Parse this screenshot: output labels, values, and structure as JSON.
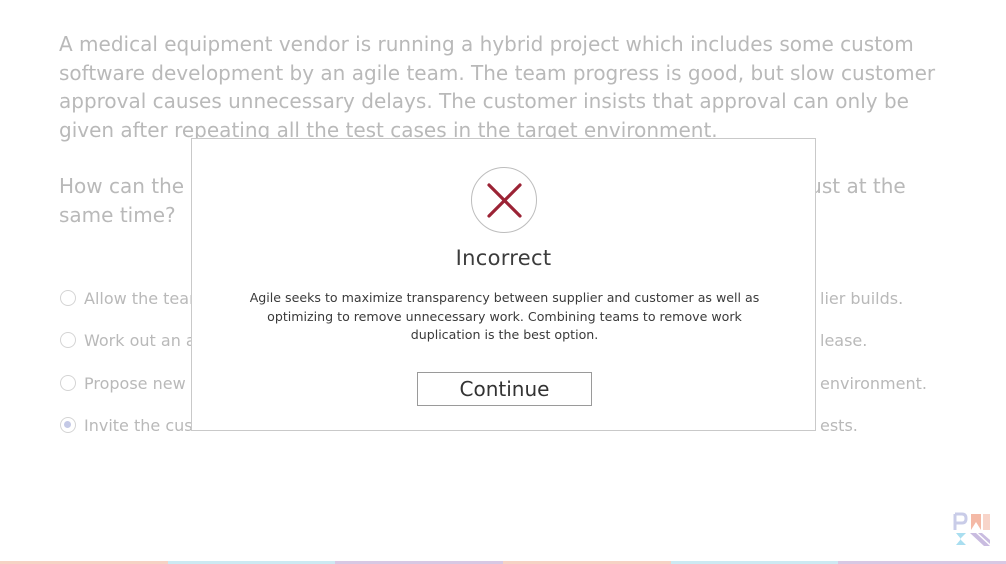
{
  "question": {
    "paragraph1": "A medical equipment vendor is running a hybrid project which includes some custom software development by an agile team.  The team progress is good, but slow customer approval causes unnecessary delays. The customer insists that approval can only be given after repeating all the test cases in the target environment.",
    "paragraph2_left": "How can the p",
    "paragraph2_right": "ust at the",
    "paragraph2_line2": "same time?"
  },
  "options": [
    {
      "left": "Allow the tear",
      "right": "lier builds.",
      "selected": false
    },
    {
      "left": "Work out an a",
      "right": "lease.",
      "selected": false
    },
    {
      "left": "Propose new",
      "right": "environment.",
      "selected": false
    },
    {
      "left": "Invite the cust",
      "right": "ests.",
      "selected": true
    }
  ],
  "modal": {
    "title": "Incorrect",
    "message": "Agile seeks to maximize transparency between supplier and customer as well as optimizing to remove unnecessary work. Combining teams to remove work duplication is the best option.",
    "continue_label": "Continue",
    "icon": "close-icon",
    "icon_color": "#9b2335"
  },
  "bottom_bar_colors": [
    "#f6d2c4",
    "#cde9f2",
    "#d8c8e4",
    "#f6d2c4",
    "#cde9f2",
    "#d8c8e4"
  ],
  "logo": {
    "text": "PMI"
  }
}
